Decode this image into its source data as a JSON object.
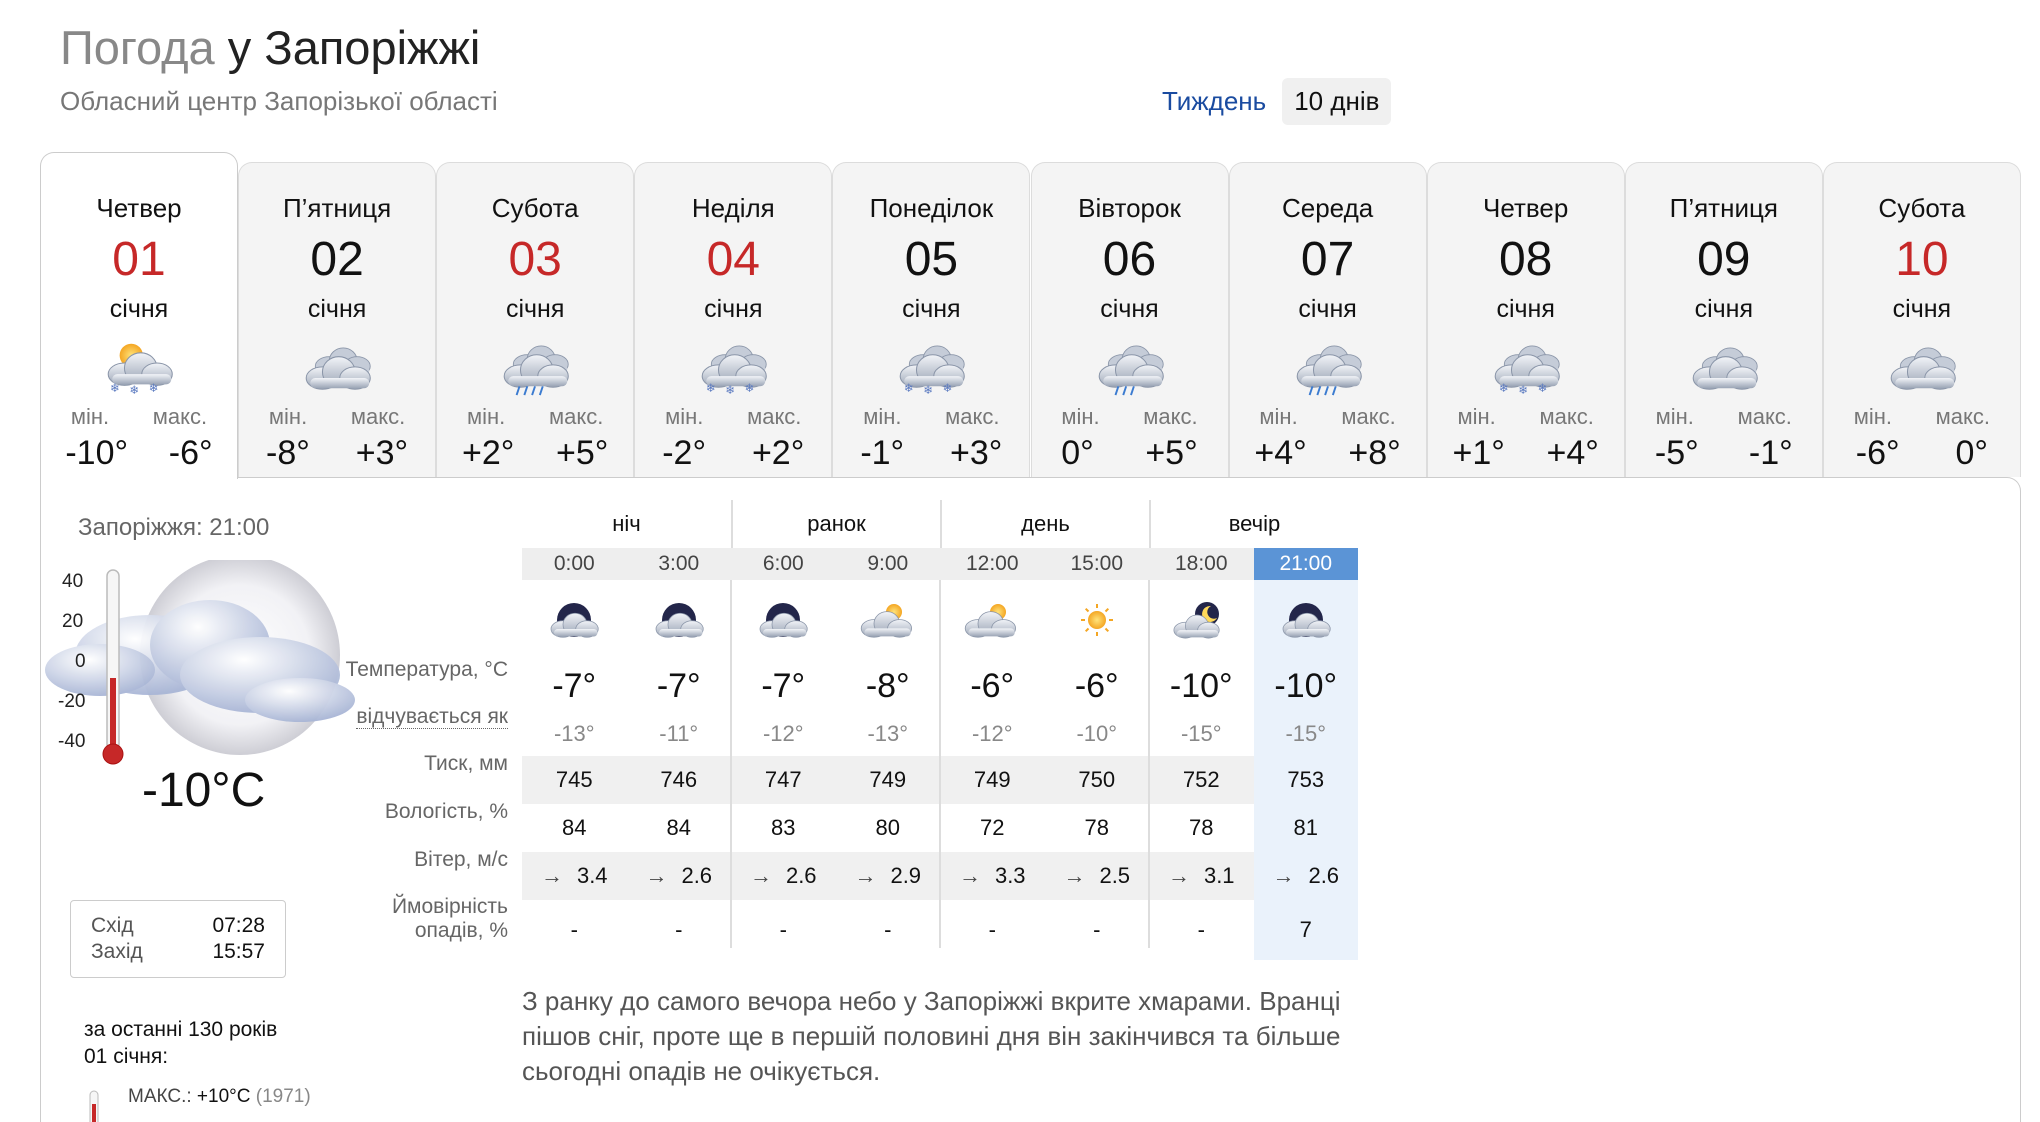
{
  "header": {
    "title_prefix": "Погода",
    "title_city": "у Запоріжжі",
    "subtitle": "Обласний центр Запорізької області",
    "period_week": "Тиждень",
    "period_10days": "10 днів"
  },
  "labels": {
    "min": "мін.",
    "max": "макс."
  },
  "days": [
    {
      "dow": "Четвер",
      "num": "01",
      "month": "січня",
      "min": "-10°",
      "max": "-6°",
      "icon": "partly-sunny-snow-icon",
      "red": true
    },
    {
      "dow": "П’ятниця",
      "num": "02",
      "month": "січня",
      "min": "-8°",
      "max": "+3°",
      "icon": "cloudy-icon",
      "red": false
    },
    {
      "dow": "Субота",
      "num": "03",
      "month": "січня",
      "min": "+2°",
      "max": "+5°",
      "icon": "cloud-rain-icon",
      "red": true
    },
    {
      "dow": "Неділя",
      "num": "04",
      "month": "січня",
      "min": "-2°",
      "max": "+2°",
      "icon": "cloud-snow-icon",
      "red": true
    },
    {
      "dow": "Понеділок",
      "num": "05",
      "month": "січня",
      "min": "-1°",
      "max": "+3°",
      "icon": "cloud-snow-icon",
      "red": false
    },
    {
      "dow": "Вівторок",
      "num": "06",
      "month": "січня",
      "min": "0°",
      "max": "+5°",
      "icon": "cloud-light-rain-icon",
      "red": false
    },
    {
      "dow": "Середа",
      "num": "07",
      "month": "січня",
      "min": "+4°",
      "max": "+8°",
      "icon": "cloud-rain-icon",
      "red": false
    },
    {
      "dow": "Четвер",
      "num": "08",
      "month": "січня",
      "min": "+1°",
      "max": "+4°",
      "icon": "cloud-snow-icon",
      "red": false
    },
    {
      "dow": "П’ятниця",
      "num": "09",
      "month": "січня",
      "min": "-5°",
      "max": "-1°",
      "icon": "cloudy-icon",
      "red": false
    },
    {
      "dow": "Субота",
      "num": "10",
      "month": "січня",
      "min": "-6°",
      "max": "0°",
      "icon": "cloudy-icon",
      "red": true
    }
  ],
  "current": {
    "location_time": "Запоріжжя: 21:00",
    "temp": "-10°C",
    "scale": [
      "40",
      "20",
      "0",
      "-20",
      "-40"
    ],
    "sunrise_label": "Схід",
    "sunrise": "07:28",
    "sunset_label": "Захід",
    "sunset": "15:57",
    "history_line1": "за останні 130 років",
    "history_line2": "01 січня:",
    "history_max_label": "МАКС.:",
    "history_max_value": "+10°C",
    "history_max_year": "(1971)"
  },
  "row_labels": {
    "temp": "Температура, °C",
    "feels": "відчувається як",
    "pressure": "Тиск, мм",
    "humidity": "Вологість, %",
    "wind": "Вітер, м/с",
    "precip_l1": "Ймовірність",
    "precip_l2": "опадів, %"
  },
  "periods": [
    "ніч",
    "ранок",
    "день",
    "вечір"
  ],
  "hours": [
    {
      "time": "0:00",
      "icon": "overcast-night-icon",
      "temp": "-7°",
      "feels": "-13°",
      "pressure": "745",
      "humidity": "84",
      "wind": "3.4",
      "precip": "-"
    },
    {
      "time": "3:00",
      "icon": "overcast-night-icon",
      "temp": "-7°",
      "feels": "-11°",
      "pressure": "746",
      "humidity": "84",
      "wind": "2.6",
      "precip": "-"
    },
    {
      "time": "6:00",
      "icon": "overcast-night-icon",
      "temp": "-7°",
      "feels": "-12°",
      "pressure": "747",
      "humidity": "83",
      "wind": "2.6",
      "precip": "-"
    },
    {
      "time": "9:00",
      "icon": "partly-cloudy-day-icon",
      "temp": "-8°",
      "feels": "-13°",
      "pressure": "749",
      "humidity": "80",
      "wind": "2.9",
      "precip": "-"
    },
    {
      "time": "12:00",
      "icon": "partly-cloudy-day-icon",
      "temp": "-6°",
      "feels": "-12°",
      "pressure": "749",
      "humidity": "72",
      "wind": "3.3",
      "precip": "-"
    },
    {
      "time": "15:00",
      "icon": "sun-icon",
      "temp": "-6°",
      "feels": "-10°",
      "pressure": "750",
      "humidity": "78",
      "wind": "2.5",
      "precip": "-"
    },
    {
      "time": "18:00",
      "icon": "partly-cloudy-night-icon",
      "temp": "-10°",
      "feels": "-15°",
      "pressure": "752",
      "humidity": "78",
      "wind": "3.1",
      "precip": "-"
    },
    {
      "time": "21:00",
      "icon": "overcast-night-icon",
      "temp": "-10°",
      "feels": "-15°",
      "pressure": "753",
      "humidity": "81",
      "wind": "2.6",
      "precip": "7"
    }
  ],
  "wind_arrow": "→",
  "description": "З ранку до самого вечора небо у Запоріжжі вкрите хмарами. Вранці пішов сніг, проте ще в першій половині дня він закінчився та більше сьогодні опадів не очікується.",
  "colors": {
    "weekend_red": "#c62828",
    "link_blue": "#1a4ba0",
    "selected_hour": "#5b94d6"
  }
}
